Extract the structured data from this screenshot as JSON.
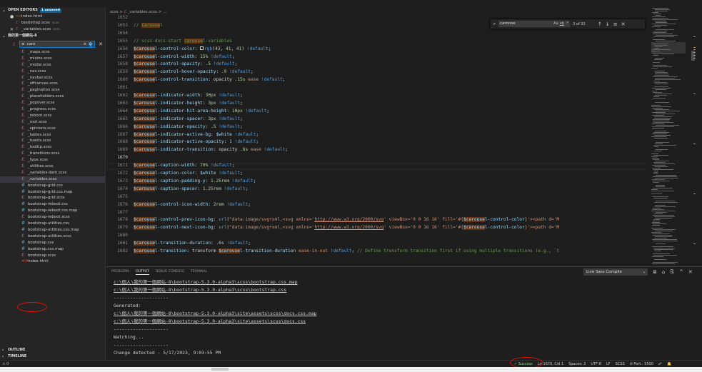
{
  "sidebar": {
    "open_editors_title": "OPEN EDITORS",
    "unsaved_badge": "1 unsaved",
    "open_editors": [
      {
        "dot": "●",
        "name": "index.html",
        "sub": "",
        "icon": "html"
      },
      {
        "dot": "",
        "name": "bootstrap.scss",
        "sub": "scss",
        "icon": "sass"
      },
      {
        "dot": "✕",
        "name": "_variables.scss",
        "sub": "scss",
        "icon": "sass"
      }
    ],
    "folder_title": "我的第一個網站-8",
    "filter": {
      "icon": "≡",
      "value": "caro",
      "filter_icon": "⩧",
      "match_icon": "⚲",
      "close": "✕"
    },
    "files": [
      {
        "name": "_maps.scss",
        "icon": "sass",
        "glyph": "ℰ"
      },
      {
        "name": "_mixins.scss",
        "icon": "sass",
        "glyph": "ℰ"
      },
      {
        "name": "_modal.scss",
        "icon": "sass",
        "glyph": "ℰ"
      },
      {
        "name": "_nav.scss",
        "icon": "sass",
        "glyph": "ℰ"
      },
      {
        "name": "_navbar.scss",
        "icon": "sass",
        "glyph": "ℰ"
      },
      {
        "name": "_offcanvas.scss",
        "icon": "sass",
        "glyph": "ℰ"
      },
      {
        "name": "_pagination.scss",
        "icon": "sass",
        "glyph": "ℰ"
      },
      {
        "name": "_placeholders.scss",
        "icon": "sass",
        "glyph": "ℰ"
      },
      {
        "name": "_popover.scss",
        "icon": "sass",
        "glyph": "ℰ"
      },
      {
        "name": "_progress.scss",
        "icon": "sass",
        "glyph": "ℰ"
      },
      {
        "name": "_reboot.scss",
        "icon": "sass",
        "glyph": "ℰ"
      },
      {
        "name": "_root.scss",
        "icon": "sass",
        "glyph": "ℰ"
      },
      {
        "name": "_spinners.scss",
        "icon": "sass",
        "glyph": "ℰ"
      },
      {
        "name": "_tables.scss",
        "icon": "sass",
        "glyph": "ℰ"
      },
      {
        "name": "_toasts.scss",
        "icon": "sass",
        "glyph": "ℰ"
      },
      {
        "name": "_tooltip.scss",
        "icon": "sass",
        "glyph": "ℰ"
      },
      {
        "name": "_transitions.scss",
        "icon": "sass",
        "glyph": "ℰ"
      },
      {
        "name": "_type.scss",
        "icon": "sass",
        "glyph": "ℰ"
      },
      {
        "name": "_utilities.scss",
        "icon": "sass",
        "glyph": "ℰ"
      },
      {
        "name": "_variables-dark.scss",
        "icon": "sass",
        "glyph": "ℰ"
      },
      {
        "name": "_variables.scss",
        "icon": "sass",
        "glyph": "ℰ",
        "selected": true
      },
      {
        "name": "bootstrap-grid.css",
        "icon": "css",
        "glyph": "#"
      },
      {
        "name": "bootstrap-grid.css.map",
        "icon": "css",
        "glyph": "#"
      },
      {
        "name": "bootstrap-grid.scss",
        "icon": "sass",
        "glyph": "ℰ"
      },
      {
        "name": "bootstrap-reboot.css",
        "icon": "css",
        "glyph": "#"
      },
      {
        "name": "bootstrap-reboot.css.map",
        "icon": "css",
        "glyph": "#"
      },
      {
        "name": "bootstrap-reboot.scss",
        "icon": "sass",
        "glyph": "ℰ"
      },
      {
        "name": "bootstrap-utilities.css",
        "icon": "css",
        "glyph": "#"
      },
      {
        "name": "bootstrap-utilities.css.map",
        "icon": "css",
        "glyph": "#"
      },
      {
        "name": "bootstrap-utilities.scss",
        "icon": "sass",
        "glyph": "ℰ"
      },
      {
        "name": "bootstrap.css",
        "icon": "css",
        "glyph": "#"
      },
      {
        "name": "bootstrap.css.map",
        "icon": "css",
        "glyph": "#"
      },
      {
        "name": "bootstrap.scss",
        "icon": "sass",
        "glyph": "ℰ"
      },
      {
        "name": "index.html",
        "icon": "html",
        "glyph": "<>"
      }
    ],
    "outline": "OUTLINE",
    "timeline": "TIMELINE"
  },
  "editor": {
    "breadcrumb": {
      "folder": "scss",
      "sep": ">",
      "file": "_variables.scss",
      "more": "..."
    },
    "find": {
      "query": "carouse",
      "case": "Aa",
      "word": "ab",
      "regex": ".*",
      "count": "3 of 33",
      "prev": "↑",
      "next": "↓",
      "sel": "≡",
      "close": "✕",
      "toggle": ">"
    },
    "current_line": "1670",
    "lines": [
      {
        "n": "1652",
        "html": ""
      },
      {
        "n": "1653",
        "html": "<span class=\"cm\">// </span><span class=\"cmh\">Carouse</span><span class=\"cm\">l</span>"
      },
      {
        "n": "1654",
        "html": ""
      },
      {
        "n": "1655",
        "html": "<span class=\"cm\">// scss-docs-start </span><span class=\"cmh\">carouse</span><span class=\"cm\">l-variables</span>"
      },
      {
        "n": "1656",
        "html": "<span class=\"hl\">$carouse</span><span class=\"v\">l-control-color</span>: <span class=\"sw\"></span><span class=\"kw\">rgb</span>(<span class=\"nm\">43</span>, <span class=\"nm\">41</span>, <span class=\"nm\">41</span>) <span class=\"kw\">!default</span>;"
      },
      {
        "n": "1657",
        "html": "<span class=\"hl\">$carouse</span><span class=\"v\">l-control-width</span>: <span class=\"nm\">15%</span> <span class=\"kw\">!default</span>;"
      },
      {
        "n": "1658",
        "html": "<span class=\"hl\">$carouse</span><span class=\"v\">l-control-opacity</span>: <span class=\"nm\">.5</span> <span class=\"kw\">!default</span>;"
      },
      {
        "n": "1659",
        "html": "<span class=\"hl\">$carouse</span><span class=\"v\">l-control-hover-opacity</span>: <span class=\"nm\">.9</span> <span class=\"kw\">!default</span>;"
      },
      {
        "n": "1660",
        "html": "<span class=\"hl\">$carouse</span><span class=\"v\">l-control-transition</span>: opacity <span class=\"nm\">.15s</span> <span class=\"st\">ease</span> <span class=\"kw\">!default</span>;"
      },
      {
        "n": "1661",
        "html": ""
      },
      {
        "n": "1662",
        "html": "<span class=\"hl\">$carouse</span><span class=\"v\">l-indicator-width</span>: <span class=\"nm\">30px</span> <span class=\"kw\">!default</span>;"
      },
      {
        "n": "1663",
        "html": "<span class=\"hl\">$carouse</span><span class=\"v\">l-indicator-height</span>: <span class=\"nm\">3px</span> <span class=\"kw\">!default</span>;"
      },
      {
        "n": "1664",
        "html": "<span class=\"hl\">$carouse</span><span class=\"v\">l-indicator-hit-area-height</span>: <span class=\"nm\">10px</span> <span class=\"kw\">!default</span>;"
      },
      {
        "n": "1665",
        "html": "<span class=\"hl\">$carouse</span><span class=\"v\">l-indicator-spacer</span>: <span class=\"nm\">3px</span> <span class=\"kw\">!default</span>;"
      },
      {
        "n": "1666",
        "html": "<span class=\"hl\">$carouse</span><span class=\"v\">l-indicator-opacity</span>: <span class=\"nm\">.5</span> <span class=\"kw\">!default</span>;"
      },
      {
        "n": "1667",
        "html": "<span class=\"hl\">$carouse</span><span class=\"v\">l-indicator-active-bg</span>: <span class=\"v\">$white</span> <span class=\"kw\">!default</span>;"
      },
      {
        "n": "1668",
        "html": "<span class=\"hl\">$carouse</span><span class=\"v\">l-indicator-active-opacity</span>: <span class=\"nm\">1</span> <span class=\"kw\">!default</span>;"
      },
      {
        "n": "1669",
        "html": "<span class=\"hl\">$carouse</span><span class=\"v\">l-indicator-transition</span>: opacity <span class=\"nm\">.6s</span> <span class=\"st\">ease</span> <span class=\"kw\">!default</span>;"
      },
      {
        "n": "1670",
        "html": ""
      },
      {
        "n": "1671",
        "html": "<span class=\"hl\">$carouse</span><span class=\"v\">l-caption-width</span>: <span class=\"nm\">70%</span> <span class=\"kw\">!default</span>;"
      },
      {
        "n": "1672",
        "html": "<span class=\"hl\">$carouse</span><span class=\"v\">l-caption-color</span>: <span class=\"v\">$white</span> <span class=\"kw\">!default</span>;"
      },
      {
        "n": "1673",
        "html": "<span class=\"hl\">$carouse</span><span class=\"v\">l-caption-padding-y</span>: <span class=\"nm\">1.25rem</span> <span class=\"kw\">!default</span>;"
      },
      {
        "n": "1674",
        "html": "<span class=\"hl\">$carouse</span><span class=\"v\">l-caption-spacer</span>: <span class=\"nm\">1.25rem</span> <span class=\"kw\">!default</span>;"
      },
      {
        "n": "1675",
        "html": ""
      },
      {
        "n": "1676",
        "html": "<span class=\"hl\">$carouse</span><span class=\"v\">l-control-icon-width</span>: <span class=\"nm\">2rem</span> <span class=\"kw\">!default</span>;"
      },
      {
        "n": "1677",
        "html": ""
      },
      {
        "n": "1678",
        "html": "<span class=\"hl\">$carouse</span><span class=\"v\">l-control-prev-icon-bg</span>: <span class=\"kw\">url</span>(<span class=\"st\">\"data:image/svg+xml,&lt;svg xmlns='</span><span class=\"ul\">http://www.w3.org/2000/svg</span><span class=\"st\">' viewBox='0 0 16 16' fill='#{</span><span class=\"hl\">$carouse</span><span class=\"v\">l-control-color</span><span class=\"st\">}'&gt;&lt;path d='M</span>"
      },
      {
        "n": "1679",
        "html": "<span class=\"hl\">$carouse</span><span class=\"v\">l-control-next-icon-bg</span>: <span class=\"kw\">url</span>(<span class=\"st\">\"data:image/svg+xml,&lt;svg xmlns='</span><span class=\"ul\">http://www.w3.org/2000/svg</span><span class=\"st\">' viewBox='0 0 16 16' fill='#{</span><span class=\"hl\">$carouse</span><span class=\"v\">l-control-color</span><span class=\"st\">}'&gt;&lt;path d='M</span>"
      },
      {
        "n": "1680",
        "html": ""
      },
      {
        "n": "1681",
        "html": "<span class=\"hl\">$carouse</span><span class=\"v\">l-transition-duration</span>: <span class=\"nm\">.6s</span> <span class=\"kw\">!default</span>;"
      },
      {
        "n": "1682",
        "html": "<span class=\"hl\">$carouse</span><span class=\"v\">l-transition</span>: transform <span class=\"hl\">$carouse</span><span class=\"v\">l-transition-duration</span> <span class=\"st\">ease-in-out</span> <span class=\"kw\">!default</span>; <span class=\"cm\">// Define transform transition first if using multiple transitions (e.g., `t</span>"
      }
    ]
  },
  "panel": {
    "tabs": [
      "PROBLEMS",
      "OUTPUT",
      "DEBUG CONSOLE",
      "TERMINAL"
    ],
    "active_tab": "OUTPUT",
    "channel": "Live Sass Compile",
    "channel_chevron": "⌄",
    "icons": [
      "≣",
      "⌂",
      "⎘",
      "^",
      "✕"
    ],
    "output": [
      {
        "text": "c:\\個人\\我的第一個網站-8\\bootstrap-5.3.0-alpha3\\scss\\bootstrap.css.map",
        "u": true
      },
      {
        "text": "c:\\個人\\我的第一個網站-8\\bootstrap-5.3.0-alpha3\\scss\\bootstrap.css",
        "u": true
      },
      {
        "text": "--------------------",
        "u": false
      },
      {
        "text": "Generated:",
        "u": false
      },
      {
        "text": "c:\\個人\\我的第一個網站-8\\bootstrap-5.3.0-alpha3\\site\\assets\\scss\\docs.css.map",
        "u": true
      },
      {
        "text": "c:\\個人\\我的第一個網站-8\\bootstrap-5.3.0-alpha3\\site\\assets\\scss\\docs.css",
        "u": true
      },
      {
        "text": "--------------------",
        "u": false
      },
      {
        "text": "Watching...",
        "u": false
      },
      {
        "text": "--------------------",
        "u": false
      },
      {
        "text": "Change detected - 5/17/2023, 9:03:55 PM",
        "u": false
      }
    ]
  },
  "status": {
    "warnings": "⚠ 0",
    "success": "✓ Success",
    "position": "Ln 1670, Col 1",
    "spaces": "Spaces: 2",
    "encoding": "UTF-8",
    "eol": "LF",
    "language": "SCSS",
    "port": "⊘ Port : 5500",
    "feedback": "☍",
    "bell": "🔔"
  },
  "colors": {
    "accent": "#007acc",
    "sass": "#cd6799",
    "css": "#519aba",
    "annotation": "#e51400"
  }
}
